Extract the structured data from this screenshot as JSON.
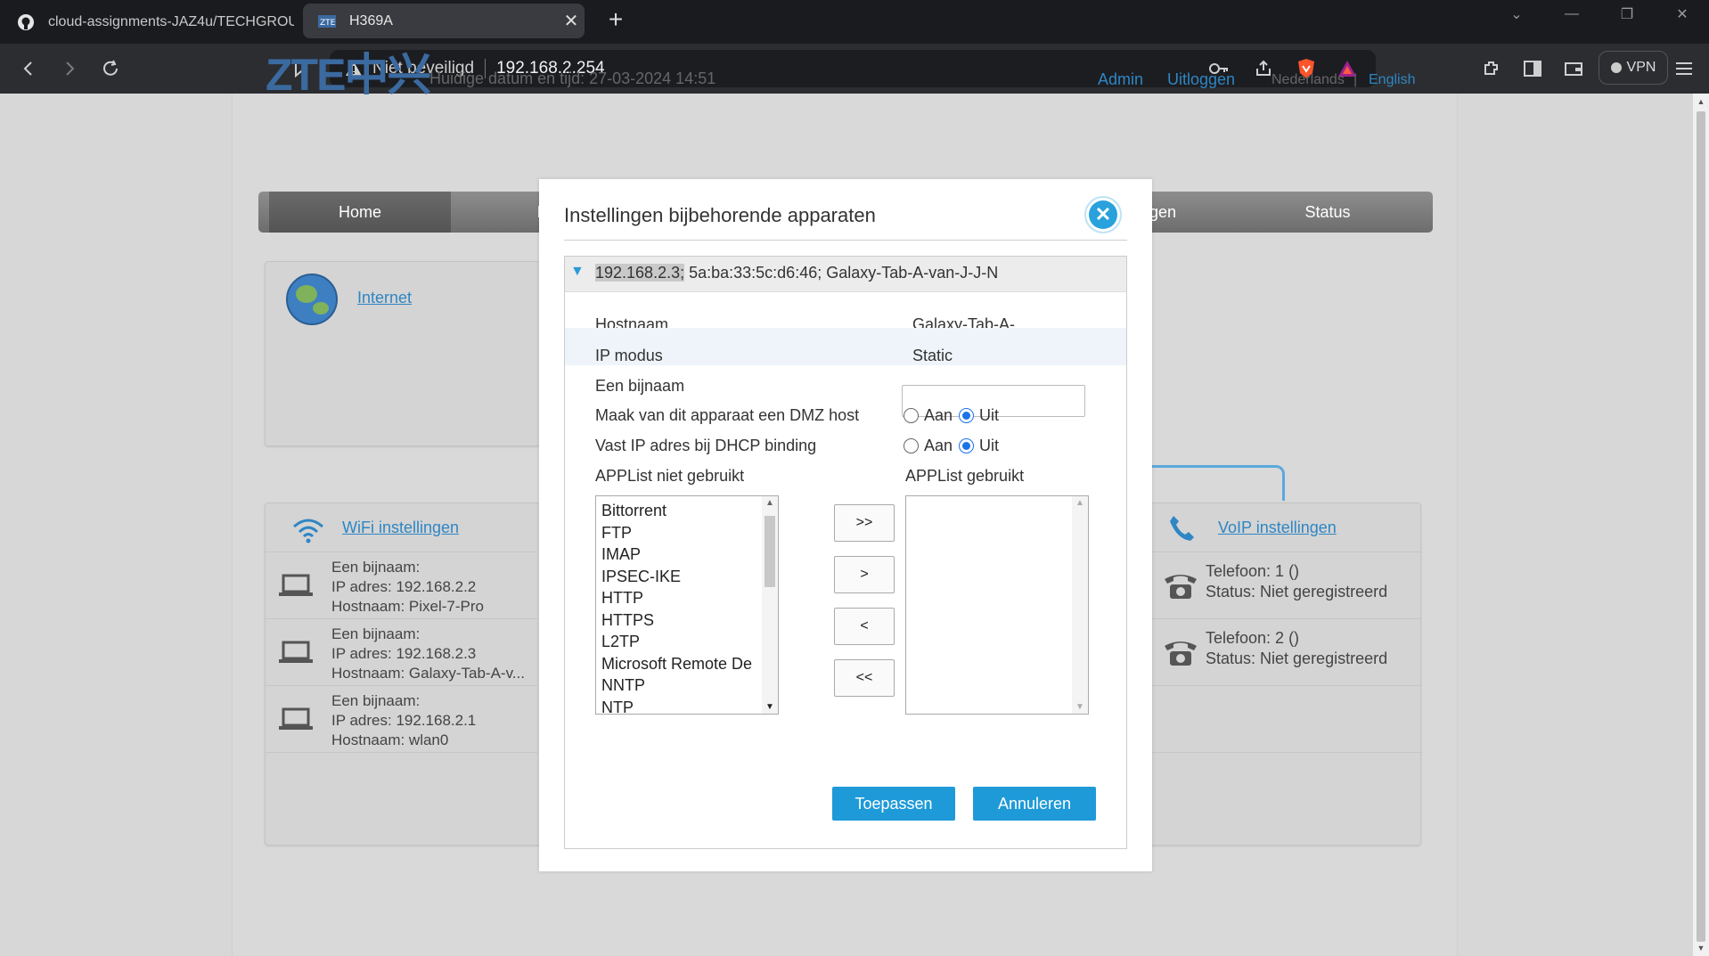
{
  "browser": {
    "tabs": [
      {
        "title": "cloud-assignments-JAZ4u/TECHGROU",
        "active": false
      },
      {
        "title": "H369A",
        "active": true
      }
    ],
    "address": {
      "security": "Niet beveiligd",
      "url": "192.168.2.254"
    },
    "vpn_label": "VPN"
  },
  "header": {
    "logo": "ZTE中兴",
    "datetime": "Huidige datum en tijd: 27-03-2024 14:51",
    "links": {
      "admin": "Admin",
      "logout": "Uitloggen",
      "lang_nl": "Nederlands",
      "lang_sep": "|",
      "lang_en": "English"
    }
  },
  "nav": {
    "home": "Home",
    "partial_left": "In",
    "partial_right": "gen",
    "status": "Status"
  },
  "cards": {
    "internet": {
      "link": "Internet"
    },
    "wifi": {
      "link": "WiFi instellingen",
      "devices": [
        {
          "alias": "Een bijnaam:",
          "ip": "IP adres: 192.168.2.2",
          "host": "Hostnaam: Pixel-7-Pro"
        },
        {
          "alias": "Een bijnaam:",
          "ip": "IP adres: 192.168.2.3",
          "host": "Hostnaam: Galaxy-Tab-A-v..."
        },
        {
          "alias": "Een bijnaam:",
          "ip": "IP adres: 192.168.2.1",
          "host": "Hostnaam: wlan0"
        }
      ]
    },
    "voip": {
      "link": "VoIP instellingen",
      "phones": [
        {
          "phone": "Telefoon: 1 ()",
          "status": "Status: Niet geregistreerd"
        },
        {
          "phone": "Telefoon: 2 ()",
          "status": "Status: Niet geregistreerd"
        }
      ]
    }
  },
  "dialog": {
    "title": "Instellingen bijbehorende apparaten",
    "device_ip": "192.168.2.3;",
    "device_rest": " 5a:ba:33:5c:d6:46; Galaxy-Tab-A-van-J-J-N",
    "hostname_label": "Hostnaam",
    "hostname_value": "Galaxy-Tab-A-...",
    "ipmode_label": "IP modus",
    "ipmode_value": "Static",
    "alias_label": "Een bijnaam",
    "alias_value": "",
    "dmz_label": "Maak van dit apparaat een DMZ host",
    "dhcp_label": "Vast IP adres bij DHCP binding",
    "radio_on": "Aan",
    "radio_off": "Uit",
    "dmz_selected": "Uit",
    "dhcp_selected": "Uit",
    "applist_unused_label": "APPList niet gebruikt",
    "applist_used_label": "APPList gebruikt",
    "applist_unused": [
      "Bittorrent",
      "FTP",
      "IMAP",
      "IPSEC-IKE",
      "HTTP",
      "HTTPS",
      "L2TP",
      "Microsoft Remote De",
      "NNTP",
      "NTP"
    ],
    "applist_used": [],
    "move_buttons": {
      "all_right": ">>",
      "right": ">",
      "left": "<",
      "all_left": "<<"
    },
    "apply": "Toepassen",
    "cancel": "Annuleren"
  },
  "colors": {
    "accent": "#1e9ad8",
    "link": "#2f86c4",
    "logo": "#3b6aa0"
  }
}
